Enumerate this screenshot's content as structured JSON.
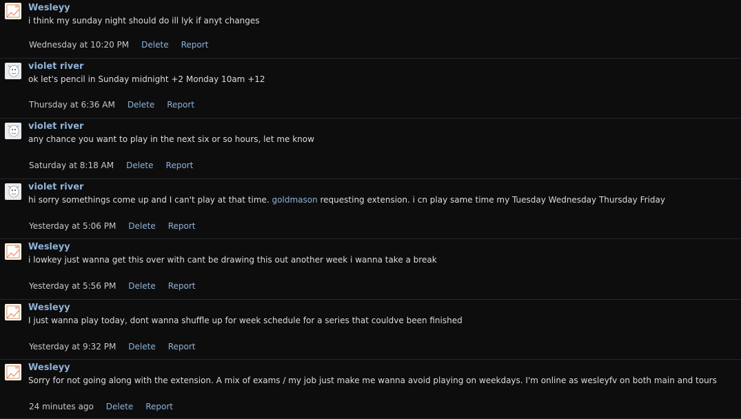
{
  "messages": [
    {
      "author": "Wesleyy",
      "avatar": "wesleyy-avatar",
      "text_before": "i think my sunday night should do ill lyk if anyt changes",
      "mention": "",
      "text_after": "",
      "time": "Wednesday at 10:20 PM",
      "delete_label": "Delete",
      "report_label": "Report"
    },
    {
      "author": "violet river",
      "avatar": "violet-river-avatar",
      "text_before": "ok let's pencil in Sunday midnight +2 Monday 10am +12",
      "mention": "",
      "text_after": "",
      "time": "Thursday at 6:36 AM",
      "delete_label": "Delete",
      "report_label": "Report"
    },
    {
      "author": "violet river",
      "avatar": "violet-river-avatar",
      "text_before": "any chance you want to play in the next six or so hours, let me know",
      "mention": "",
      "text_after": "",
      "time": "Saturday at 8:18 AM",
      "delete_label": "Delete",
      "report_label": "Report"
    },
    {
      "author": "violet river",
      "avatar": "violet-river-avatar",
      "text_before": "hi sorry somethings come up and I can't play at that time. ",
      "mention": "goldmason",
      "text_after": " requesting extension. i cn play same time my Tuesday Wednesday Thursday Friday",
      "time": "Yesterday at 5:06 PM",
      "delete_label": "Delete",
      "report_label": "Report"
    },
    {
      "author": "Wesleyy",
      "avatar": "wesleyy-avatar",
      "text_before": "i lowkey just wanna get this over with cant be drawing this out another week i wanna take a break",
      "mention": "",
      "text_after": "",
      "time": "Yesterday at 5:56 PM",
      "delete_label": "Delete",
      "report_label": "Report"
    },
    {
      "author": "Wesleyy",
      "avatar": "wesleyy-avatar",
      "text_before": "I just wanna play today, dont wanna shuffle up for week schedule for a series that couldve been finished",
      "mention": "",
      "text_after": "",
      "time": "Yesterday at 9:32 PM",
      "delete_label": "Delete",
      "report_label": "Report"
    },
    {
      "author": "Wesleyy",
      "avatar": "wesleyy-avatar",
      "text_before": "Sorry for not going along with the extension. A mix of exams / my job just make me wanna avoid playing on weekdays. I'm online as wesleyfv on both main and tours",
      "mention": "",
      "text_after": "",
      "time": "24 minutes ago",
      "delete_label": "Delete",
      "report_label": "Report"
    }
  ]
}
